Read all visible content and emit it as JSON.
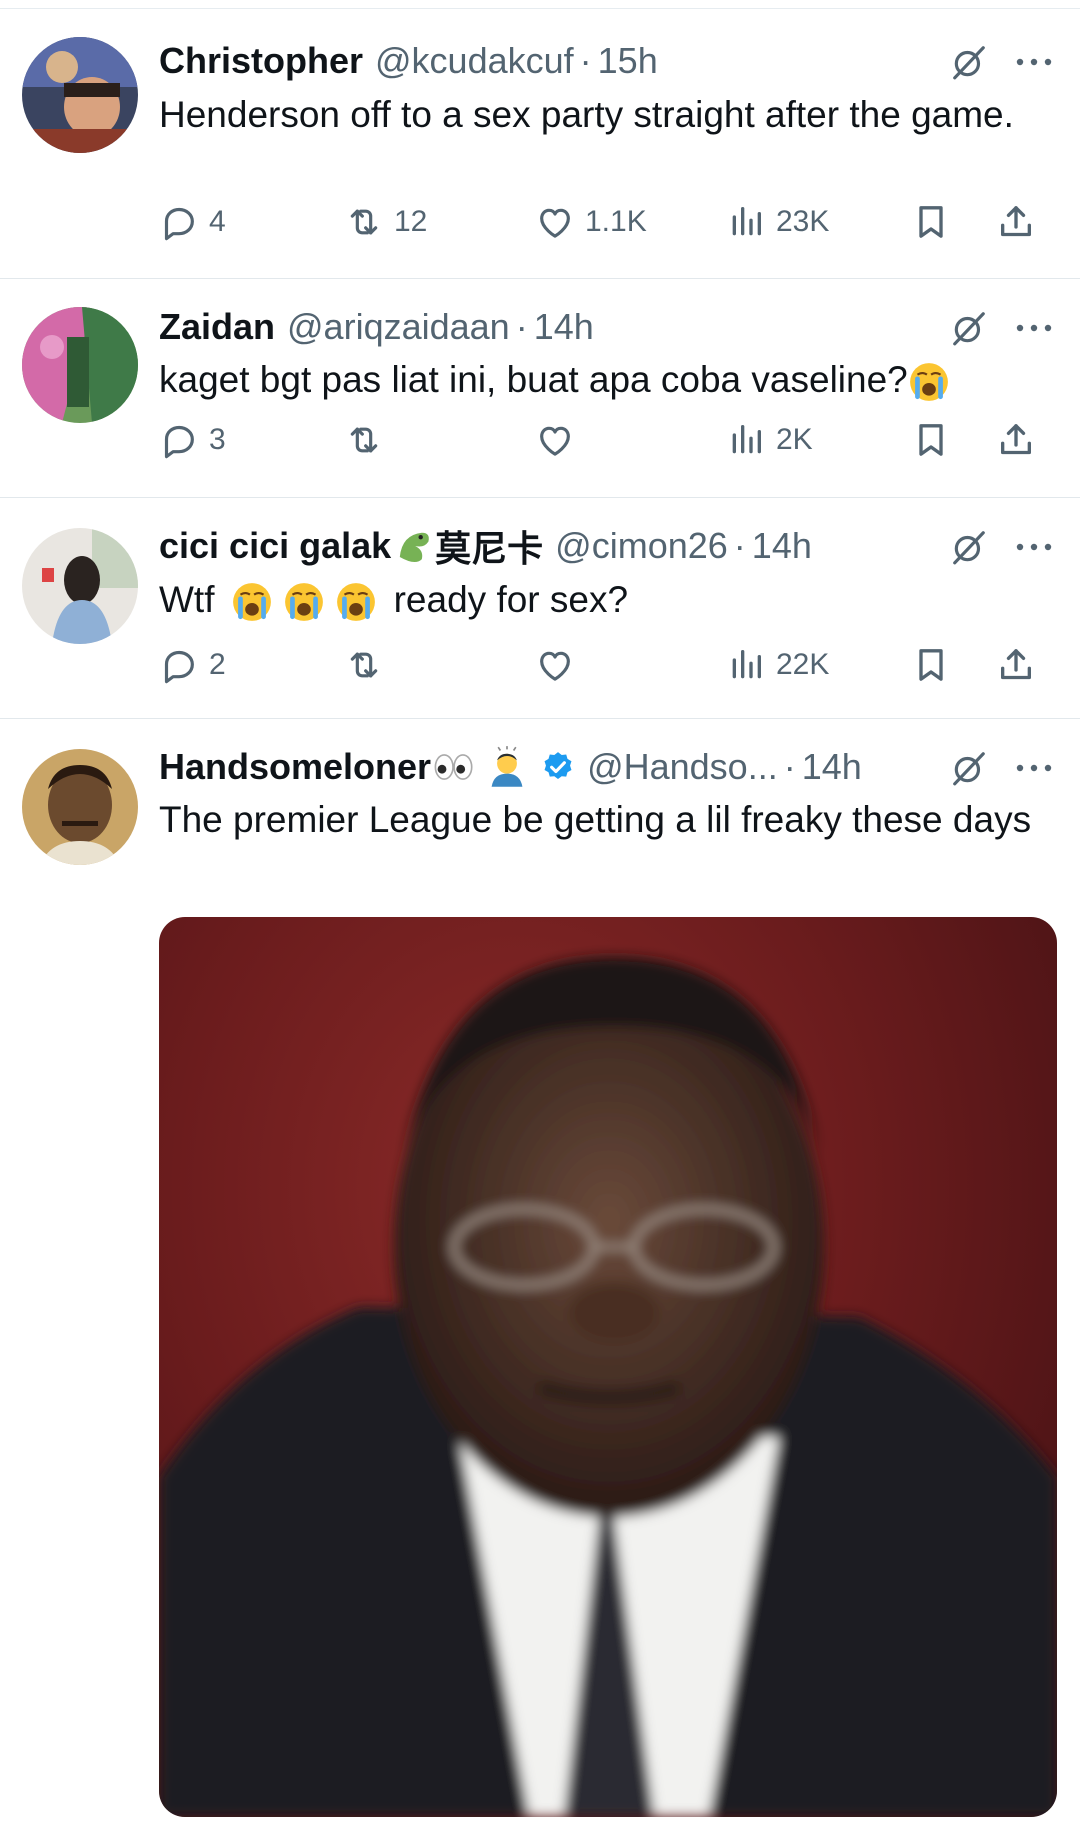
{
  "tweets": [
    {
      "name": "Christopher",
      "handle": "@kcudakcuf",
      "time": "15h",
      "text": "Henderson off to a sex party straight after the game.",
      "replies": "4",
      "retweets": "12",
      "likes": "1.1K",
      "views": "23K"
    },
    {
      "name": "Zaidan",
      "handle": "@ariqzaidaan",
      "time": "14h",
      "text": "kaget bgt pas liat ini, buat apa coba vaseline?",
      "replies": "3",
      "retweets": "",
      "likes": "",
      "views": "2K"
    },
    {
      "name": "cici cici galak",
      "name_suffix": "莫尼卡",
      "handle": "@cimon26",
      "time": "14h",
      "text_before": "Wtf",
      "text_after": "ready for sex?",
      "replies": "2",
      "retweets": "",
      "likes": "",
      "views": "22K"
    },
    {
      "name": "Handsomeloner",
      "handle": "@Handso...",
      "time": "14h",
      "text": "The premier League be getting a lil freaky these days",
      "verified": true
    }
  ],
  "separator": "·",
  "colors": {
    "text": "#0f1419",
    "muted": "#536471",
    "verified": "#1d9bf0"
  },
  "icons": [
    "reply-icon",
    "retweet-icon",
    "like-icon",
    "views-icon",
    "bookmark-icon",
    "share-icon",
    "grok-icon",
    "more-icon",
    "crying-emoji",
    "dragon-emoji",
    "eyes-emoji",
    "person-bowing-emoji",
    "verified-badge-icon"
  ]
}
